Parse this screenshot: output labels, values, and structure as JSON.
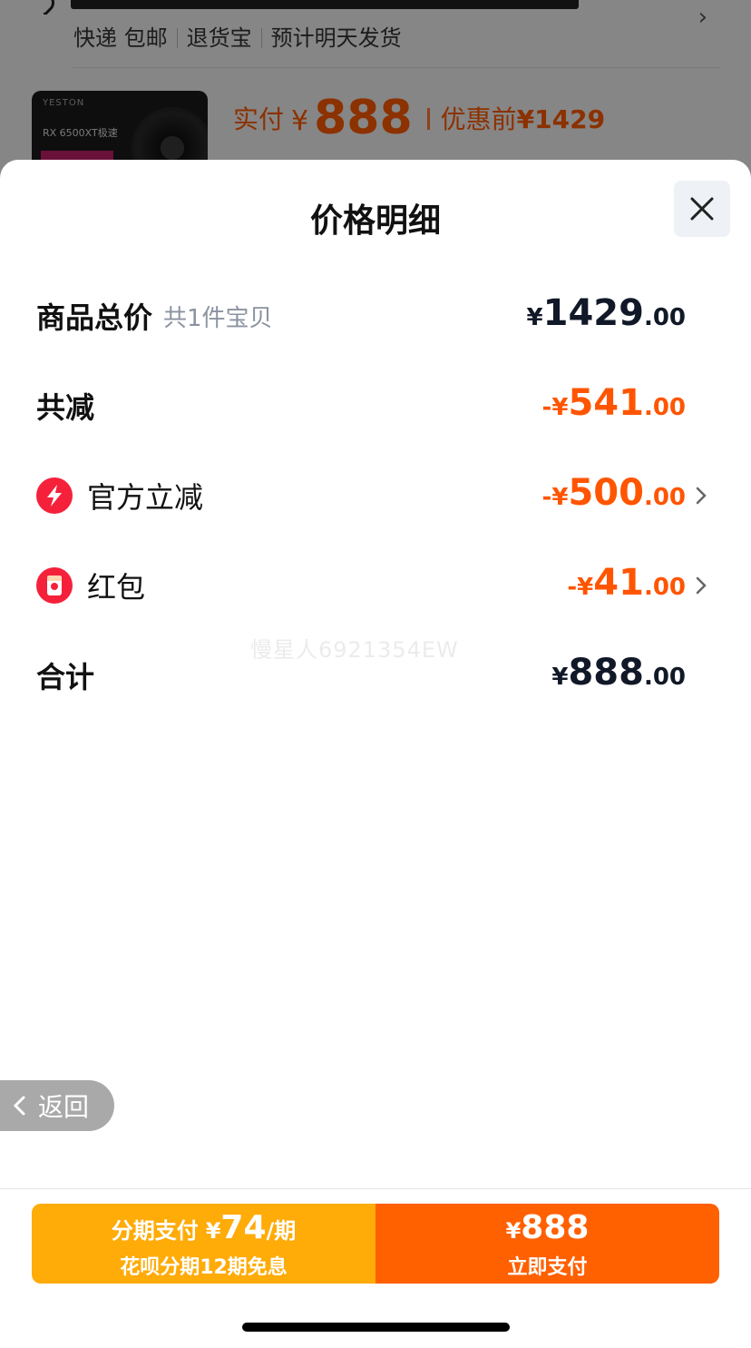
{
  "background": {
    "delivery_tags": [
      "快递 包邮",
      "退货宝",
      "预计明天发货"
    ],
    "product_image": {
      "brand": "YESTON",
      "model": "RX 6500XT极速"
    },
    "price": {
      "label": "实付",
      "currency": "¥",
      "value": "888",
      "original_label": "优惠前",
      "original": "¥1429"
    }
  },
  "sheet": {
    "title": "价格明细",
    "close_icon": "close-icon",
    "rows": [
      {
        "label": "商品总价",
        "sub": "共1件宝贝",
        "currency": "¥",
        "int": "1429",
        "dec": ".00",
        "color": "#111827"
      },
      {
        "label": "共减",
        "currency": "-¥",
        "int": "541",
        "dec": ".00",
        "color": "#ff5500"
      },
      {
        "label": "官方立减",
        "icon": "lightning-icon",
        "currency": "-¥",
        "int": "500",
        "dec": ".00",
        "color": "#ff5500"
      },
      {
        "label": "红包",
        "icon": "red-packet-icon",
        "currency": "-¥",
        "int": "41",
        "dec": ".00",
        "color": "#ff5500"
      },
      {
        "label": "合计",
        "currency": "¥",
        "int": "888",
        "dec": ".00",
        "color": "#111827"
      }
    ],
    "watermark": "慢星人6921354EW"
  },
  "back_button": {
    "label": "返回"
  },
  "footer": {
    "installment": {
      "label": "分期支付",
      "currency": "¥",
      "amount": "74",
      "unit": "/期",
      "sub": "花呗分期12期免息"
    },
    "pay_now": {
      "currency": "¥",
      "amount": "888",
      "label": "立即支付"
    }
  },
  "colors": {
    "accent_orange": "#ff5500",
    "installment_bg": "#ffab08",
    "pay_bg": "#ff6000",
    "icon_red": "#f5213b"
  }
}
